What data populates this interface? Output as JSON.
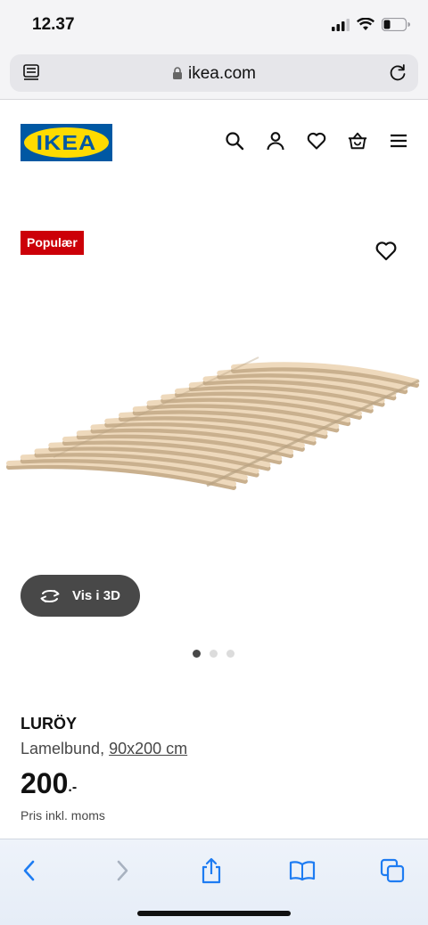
{
  "status_bar": {
    "time": "12.37"
  },
  "browser": {
    "url": "ikea.com"
  },
  "header": {
    "logo_text": "IKEA",
    "icons": [
      "search-icon",
      "account-icon",
      "favourites-icon",
      "basket-icon",
      "menu-icon"
    ]
  },
  "gallery": {
    "badge": "Populær",
    "view_3d_label": "Vis i 3D",
    "slide_count": 3,
    "active_slide": 1
  },
  "product": {
    "name": "LURÖY",
    "type": "Lamelbund,",
    "size": "90x200 cm",
    "price": "200",
    "price_suffix": ".-",
    "price_note": "Pris inkl. moms"
  },
  "toolbar": {
    "icons": [
      "back-icon",
      "forward-icon",
      "share-icon",
      "bookmarks-icon",
      "tabs-icon"
    ]
  },
  "colors": {
    "ikea_blue": "#0058a3",
    "ikea_yellow": "#ffdb00",
    "badge_red": "#cc0008",
    "safari_blue": "#1e7cf2"
  }
}
